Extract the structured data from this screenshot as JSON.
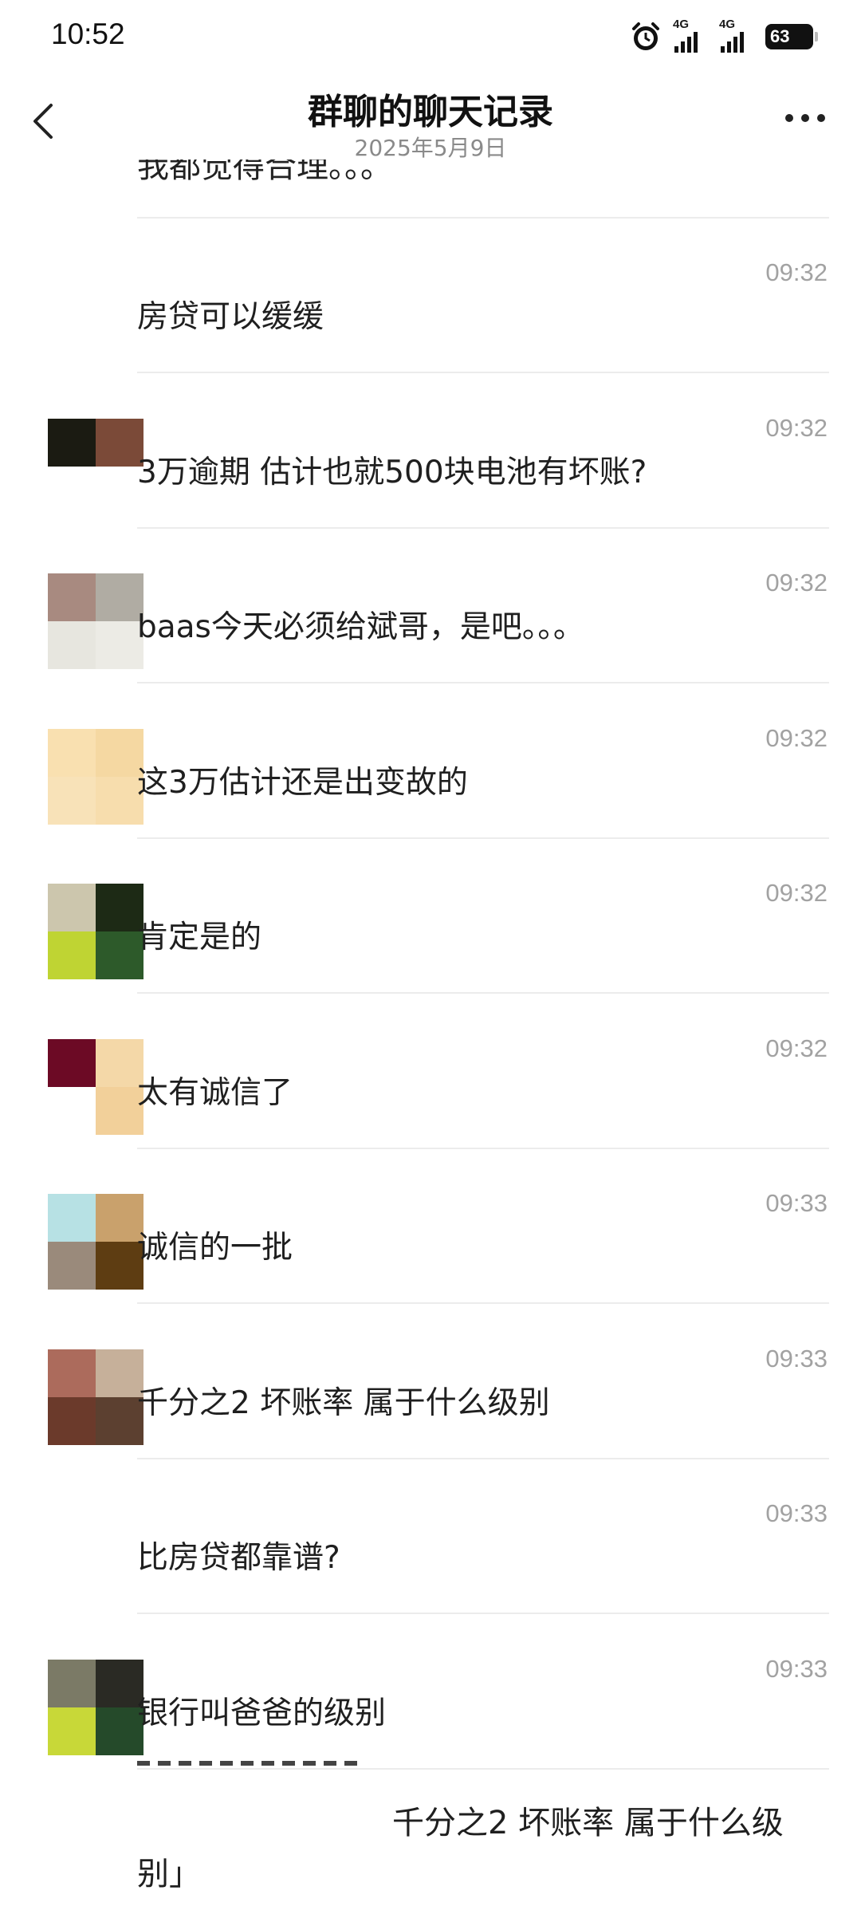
{
  "status_bar": {
    "time": "10:52",
    "network_1": "4G",
    "network_2": "4G",
    "battery": "63"
  },
  "header": {
    "title": "群聊的聊天记录",
    "date": "2025年5月9日"
  },
  "partial_top_text": "我都觉得合理。。。",
  "messages": [
    {
      "time": "09:32",
      "text": "房贷可以缓缓",
      "avatar": []
    },
    {
      "time": "09:32",
      "text": "3万逾期 估计也就500块电池有坏账?",
      "avatar": [
        "#1b1b12",
        "#7b4a38",
        "#ffffff",
        "#ffffff"
      ]
    },
    {
      "time": "09:32",
      "text": "baas今天必须给斌哥，是吧。。。",
      "avatar": [
        "#a88a80",
        "#b0aca3",
        "#e7e6df",
        "#ecebe5"
      ]
    },
    {
      "time": "09:32",
      "text": "这3万估计还是出变故的",
      "avatar": [
        "#f9e0b0",
        "#f5d8a2",
        "#f8e2b8",
        "#f7ddad"
      ]
    },
    {
      "time": "09:32",
      "text": "肯定是的",
      "avatar": [
        "#ccc6ad",
        "#1d2a15",
        "#bfd433",
        "#2d5a2a"
      ]
    },
    {
      "time": "09:32",
      "text": "太有诚信了",
      "avatar": [
        "#6c0a25",
        "#f4d8a8",
        "#ffffff",
        "#f2d09a"
      ]
    },
    {
      "time": "09:33",
      "text": "诚信的一批",
      "avatar": [
        "#b7e1e4",
        "#c9a16c",
        "#9a8a7b",
        "#5e3d12"
      ]
    },
    {
      "time": "09:33",
      "text": "千分之2 坏账率 属于什么级别",
      "avatar": [
        "#ac6b5c",
        "#c6b09a",
        "#6b3a2b",
        "#5c4030"
      ]
    },
    {
      "time": "09:33",
      "text": "比房贷都靠谱?",
      "avatar": []
    },
    {
      "time": "09:33",
      "text": "银行叫爸爸的级别",
      "avatar": [
        "#7b7a66",
        "#2a2a24",
        "#c8d838",
        "#254a2a"
      ]
    }
  ],
  "quote": {
    "text": "千分之2 坏账率 属于什么级别」"
  },
  "colors": {
    "time_gray": "#a2a2a2",
    "divider": "#ececec",
    "subtitle_gray": "#8a8a8a"
  }
}
